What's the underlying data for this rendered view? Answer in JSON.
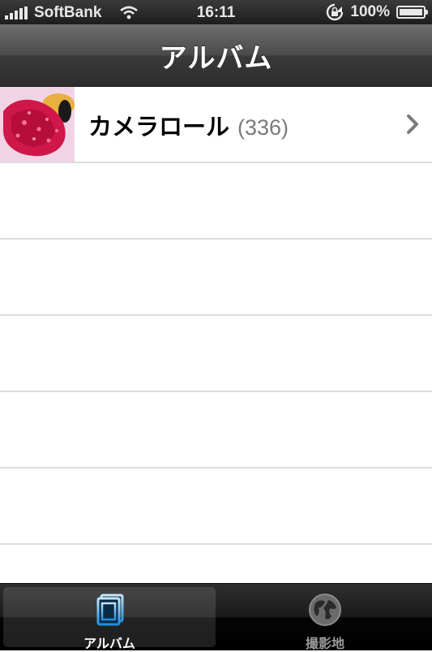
{
  "status_bar": {
    "carrier": "SoftBank",
    "time": "16:11",
    "battery_text": "100%",
    "battery_level": 1.0,
    "signal_bars": 5,
    "icons": [
      "wifi-icon",
      "rotation-lock-icon",
      "battery-icon"
    ]
  },
  "nav": {
    "title": "アルバム"
  },
  "albums": [
    {
      "name": "カメラロール",
      "count": "(336)",
      "icon": "chevron-right-icon"
    }
  ],
  "tabs": [
    {
      "label": "アルバム",
      "icon": "albums-icon",
      "selected": true
    },
    {
      "label": "撮影地",
      "icon": "globe-icon",
      "selected": false
    }
  ],
  "colors": {
    "tab_selected_icon": "#4fb3ff",
    "navbar": "#4a4a4a",
    "count_text": "#7a7a7a"
  }
}
